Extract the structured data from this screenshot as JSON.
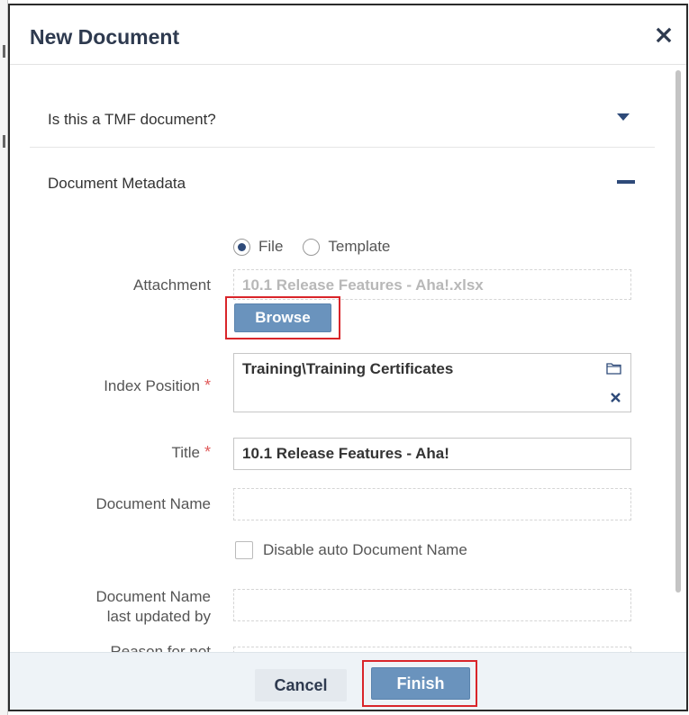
{
  "dialog": {
    "title": "New Document"
  },
  "sections": {
    "tmf_label": "Is this a TMF document?",
    "metadata_label": "Document Metadata"
  },
  "form": {
    "source_options": [
      "File",
      "Template"
    ],
    "selected_source": "File",
    "attachment_label": "Attachment",
    "attachment_value": "10.1 Release Features - Aha!.xlsx",
    "browse_label": "Browse",
    "index_position_label": "Index Position",
    "index_position_value": "Training\\Training Certificates",
    "title_label": "Title",
    "title_value": "10.1 Release Features - Aha!",
    "document_name_label": "Document Name",
    "document_name_value": "",
    "disable_auto_label": "Disable auto Document Name",
    "disable_auto_checked": false,
    "last_updated_label_line1": "Document Name",
    "last_updated_label_line2": "last updated by",
    "reason_label": "Reason for not",
    "required_marker": "*"
  },
  "footer": {
    "cancel_label": "Cancel",
    "finish_label": "Finish"
  },
  "icons": {
    "close": "close-icon",
    "expand": "caret-down-icon",
    "collapse": "minus-icon",
    "folder": "folder-icon",
    "clear": "x-icon"
  },
  "colors": {
    "accent": "#6a93bd",
    "heading": "#2e3a4f",
    "highlight": "#d9252a",
    "required": "#e05a5a"
  }
}
